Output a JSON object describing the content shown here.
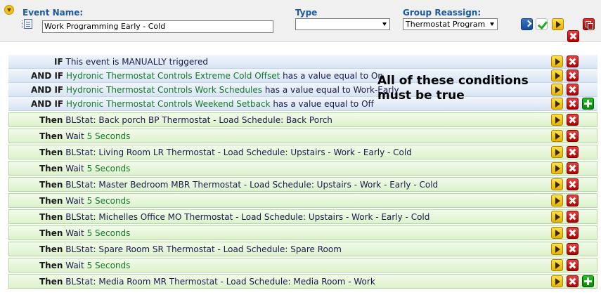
{
  "header": {
    "event_name_label": "Event Name:",
    "event_name_value": "Work Programming Early - Cold",
    "type_label": "Type",
    "type_value": "",
    "group_label": "Group Reassign:",
    "group_value": "Thermostat Program"
  },
  "conditions": [
    {
      "keyword": "IF",
      "parts": [
        {
          "t": "This event is MANUALLY triggered",
          "hl": false
        }
      ]
    },
    {
      "keyword": "AND IF",
      "parts": [
        {
          "t": "Hydronic Thermostat Controls Extreme Cold Offset",
          "hl": true
        },
        {
          "t": " has a value equal to ",
          "hl": false
        },
        {
          "t": "On",
          "hl": false
        }
      ]
    },
    {
      "keyword": "AND IF",
      "parts": [
        {
          "t": "Hydronic Thermostat Controls Work Schedules",
          "hl": true
        },
        {
          "t": " has a value equal to ",
          "hl": false
        },
        {
          "t": "Work-Early",
          "hl": false
        }
      ]
    },
    {
      "keyword": "AND IF",
      "parts": [
        {
          "t": "Hydronic Thermostat Controls Weekend Setback",
          "hl": true
        },
        {
          "t": " has a value equal to ",
          "hl": false
        },
        {
          "t": "Off",
          "hl": false
        }
      ]
    }
  ],
  "note": {
    "line1": "All of these conditions",
    "line2": "must be true"
  },
  "actions": [
    {
      "keyword": "Then",
      "parts": [
        {
          "t": "BLStat: Back porch BP Thermostat - Load Schedule: Back Porch",
          "hl": false
        }
      ]
    },
    {
      "keyword": "Then",
      "parts": [
        {
          "t": "Wait ",
          "hl": false
        },
        {
          "t": "5 Seconds",
          "hl": true
        }
      ]
    },
    {
      "keyword": "Then",
      "parts": [
        {
          "t": "BLStat: Living Room LR Thermostat - Load Schedule: Upstairs - Work - Early - Cold",
          "hl": false
        }
      ]
    },
    {
      "keyword": "Then",
      "parts": [
        {
          "t": "Wait ",
          "hl": false
        },
        {
          "t": "5 Seconds",
          "hl": true
        }
      ]
    },
    {
      "keyword": "Then",
      "parts": [
        {
          "t": "BLStat: Master Bedroom MBR Thermostat - Load Schedule: Upstairs - Work - Early - Cold",
          "hl": false
        }
      ]
    },
    {
      "keyword": "Then",
      "parts": [
        {
          "t": "Wait ",
          "hl": false
        },
        {
          "t": "5 Seconds",
          "hl": true
        }
      ]
    },
    {
      "keyword": "Then",
      "parts": [
        {
          "t": "BLStat: Michelles Office MO Thermostat - Load Schedule: Upstairs - Work - Early - Cold",
          "hl": false
        }
      ]
    },
    {
      "keyword": "Then",
      "parts": [
        {
          "t": "Wait ",
          "hl": false
        },
        {
          "t": "5 Seconds",
          "hl": true
        }
      ]
    },
    {
      "keyword": "Then",
      "parts": [
        {
          "t": "BLStat: Spare Room SR Thermostat - Load Schedule: Spare Room",
          "hl": false
        }
      ]
    },
    {
      "keyword": "Then",
      "parts": [
        {
          "t": "Wait ",
          "hl": false
        },
        {
          "t": "5 Seconds",
          "hl": true
        }
      ]
    },
    {
      "keyword": "Then",
      "parts": [
        {
          "t": "BLStat: Media Room MR Thermostat - Load Schedule: Media Room - Work",
          "hl": false
        }
      ]
    }
  ]
}
